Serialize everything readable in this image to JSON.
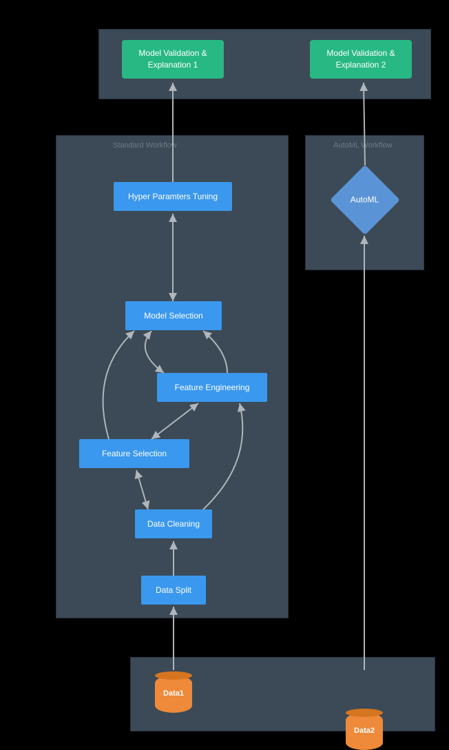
{
  "topPanel": {
    "validation1": "Model Validation & Explanation 1",
    "validation2": "Model Validation & Explanation 2"
  },
  "standardWorkflow": {
    "label": "Standard Workflow",
    "hyperParams": "Hyper Paramters Tuning",
    "modelSelection": "Model Selection",
    "featureEngineering": "Feature Engineering",
    "featureSelection": "Feature Selection",
    "dataCleaning": "Data Cleaning",
    "dataSplit": "Data Split"
  },
  "automlWorkflow": {
    "label": "AutoML Workflow",
    "automl": "AutoML"
  },
  "bottomPanel": {
    "data1": "Data1",
    "data2": "Data2"
  }
}
